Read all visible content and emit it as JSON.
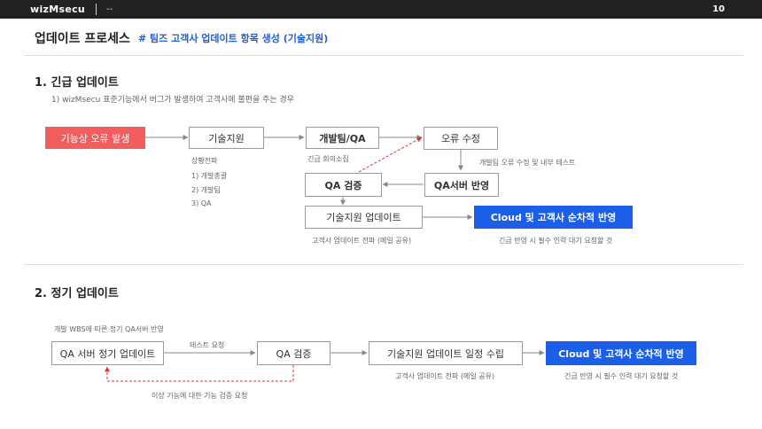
{
  "header": {
    "brand": "wizMsecu",
    "crumb": "--",
    "page": "10"
  },
  "title": "업데이트 프로세스",
  "subtitle": "# 팀즈 고객사 업데이트 항목 생성 (기술지원)",
  "section1": {
    "heading": "1.  긴급 업데이트",
    "desc": "1) wizMsecu 표준기능에서 버그가 발생하여 고객사에 불편을 주는 경우",
    "boxes": {
      "error": "기능상 오류 발생",
      "support": "기술지원",
      "devqa": "개발팀/QA",
      "fix": "오류 수정",
      "qaverify": "QA 검증",
      "qaserver": "QA서버 반영",
      "supportupdate": "기술지원 업데이트",
      "cloud": "Cloud 및 고객사 순차적 반영"
    },
    "notes": {
      "situation": "상황전파",
      "s1": "1) 개발총괄",
      "s2": "2) 개발팀",
      "s3": "3) QA",
      "meeting": "긴급 회의소집",
      "devtest": "개발팀 오류 수정 및 내부 테스트",
      "share": "고객사 업데이트 전파 (메일 공유)",
      "urgent": "긴급 반영 시 필수 인력 대기 요청할 것"
    }
  },
  "section2": {
    "heading": "2.  정기 업데이트",
    "desc": "개발 WBS에 따른 정기 QA서버 반영",
    "boxes": {
      "qaserver": "QA 서버 정기 업데이트",
      "qaverify": "QA 검증",
      "schedule": "기술지원 업데이트 일정  수립",
      "cloud": "Cloud 및 고객사 순차적 반영"
    },
    "notes": {
      "testreq": "테스트 요청",
      "recheck": "이상 기능에 대한 기능 검증 요청",
      "share": "고객사 업데이트 전파 (메일 공유)",
      "urgent": "긴급 반영 시 필수 인력 대기 요청할 것"
    }
  },
  "colors": {
    "error": "#f25d5d",
    "accent": "#1b5fe8",
    "line": "#888888",
    "feedback": "#e0333a"
  }
}
